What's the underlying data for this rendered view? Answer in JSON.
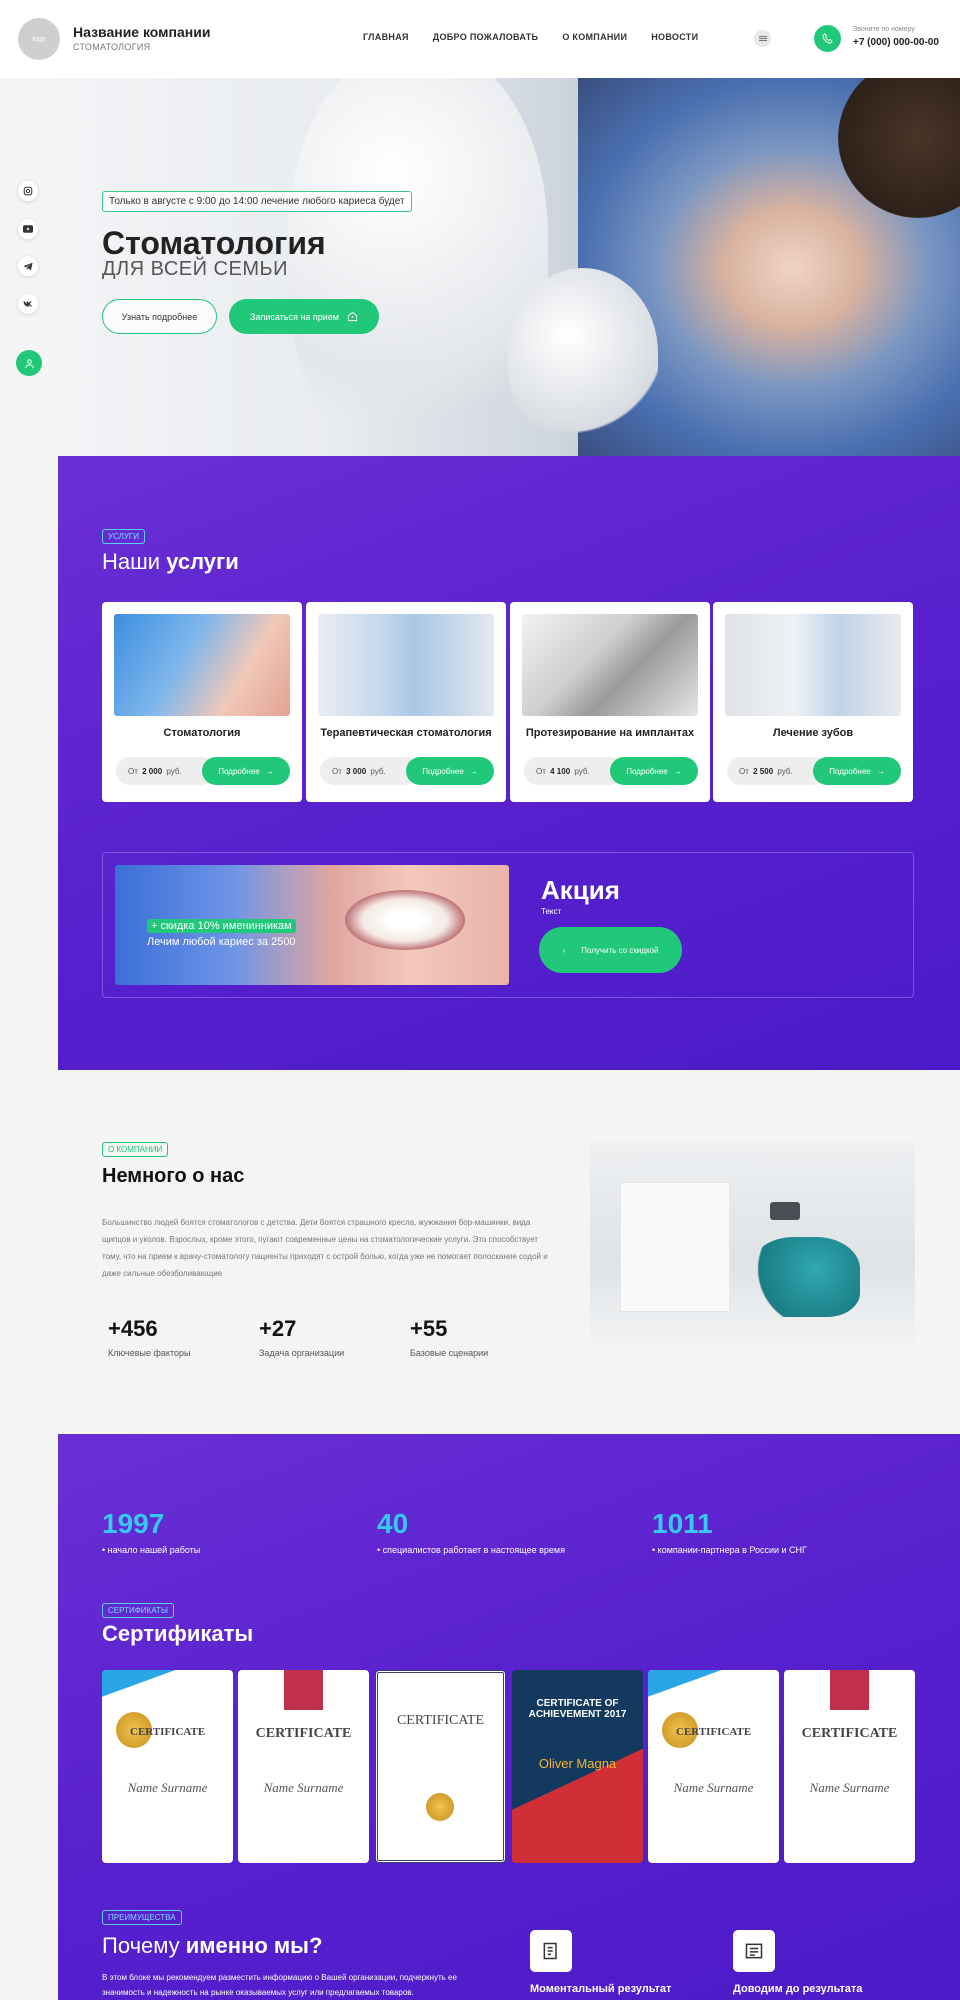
{
  "header": {
    "logo_text": "logo",
    "company_name": "Название компании",
    "company_sub": "СТОМАТОЛОГИЯ",
    "nav": [
      "ГЛАВНАЯ",
      "ДОБРО ПОЖАЛОВАТЬ",
      "О КОМПАНИИ",
      "НОВОСТИ"
    ],
    "phone_label": "Звоните по номеру",
    "phone_number": "+7 (000) 000-00-00"
  },
  "social": [
    "instagram-icon",
    "youtube-icon",
    "telegram-icon",
    "vk-icon"
  ],
  "hero": {
    "notice": "Только в августе с 9:00 до 14:00 лечение любого кариеса будет",
    "title": "Стоматология",
    "subtitle": "ДЛЯ ВСЕЙ СЕМЬИ",
    "btn_more": "Узнать подробнее",
    "btn_signup": "Записаться на прием"
  },
  "services": {
    "tag": "УСЛУГИ",
    "title_light": "Наши ",
    "title_bold": "услуги",
    "price_prefix": "От",
    "price_suffix": "руб.",
    "more_label": "Подробнее",
    "items": [
      {
        "name": "Стоматология",
        "price": "2 000"
      },
      {
        "name": "Терапевтическая стоматология",
        "price": "3 000"
      },
      {
        "name": "Протезирование на имплантах",
        "price": "4 100"
      },
      {
        "name": "Лечение зубов",
        "price": "2 500"
      }
    ]
  },
  "promo": {
    "badge": "+ скидка 10% именинникам",
    "line": "Лечим любой кариес за 2500",
    "title": "Акция",
    "text": "Текст",
    "button": "Получить со скидкой"
  },
  "about": {
    "tag": "О КОМПАНИИ",
    "title": "Немного о нас",
    "text": "Большинство людей боятся стоматологов с детства. Дети боятся страшного кресла, жужжания бор-машинки, вида щипцов и уколов. Взрослых, кроме этого, пугают современные цены на стоматологические услуги. Это способствует тому, что на прием к врачу-стоматологу пациенты приходят с острой болью, когда уже не помогает полоскание содой и даже сильные обезболивающие",
    "stats": [
      {
        "num": "+456",
        "label": "Ключевые факторы"
      },
      {
        "num": "+27",
        "label": "Задача организации"
      },
      {
        "num": "+55",
        "label": "Базовые сценарии"
      }
    ]
  },
  "numbers": [
    {
      "num": "1997",
      "label": "• начало нашей работы"
    },
    {
      "num": "40",
      "label": "• специалистов работает в настоящее время"
    },
    {
      "num": "1011",
      "label": "• компании-партнера в России и СНГ"
    }
  ],
  "certificates": {
    "tag": "СЕРТИФИКАТЫ",
    "title": "Сертификаты",
    "items": [
      {
        "title": "CERTIFICATE",
        "sig": "Name Surname"
      },
      {
        "title": "CERTIFICATE",
        "sig": "Name Surname"
      },
      {
        "title": "CERTIFICATE",
        "sig": ""
      },
      {
        "title": "CERTIFICATE OF ACHIEVEMENT 2017",
        "sig": "Oliver Magna"
      },
      {
        "title": "CERTIFICATE",
        "sig": "Name Surname"
      },
      {
        "title": "CERTIFICATE",
        "sig": "Name Surname"
      }
    ]
  },
  "why": {
    "tag": "ПРЕИМУЩЕСТВА",
    "title_light": "Почему ",
    "title_bold": "именно мы?",
    "text": "В этом блоке мы рекомендуем разместить информацию о Вашей организации, подчеркнуть ее значимость и надежность на рынке оказываемых услуг или предлагаемых товаров.",
    "items": [
      "Моментальный результат",
      "Доводим до результата"
    ]
  },
  "colors": {
    "accent": "#22c87a",
    "purple": "#5a21cf",
    "cyan": "#35c9f1"
  }
}
